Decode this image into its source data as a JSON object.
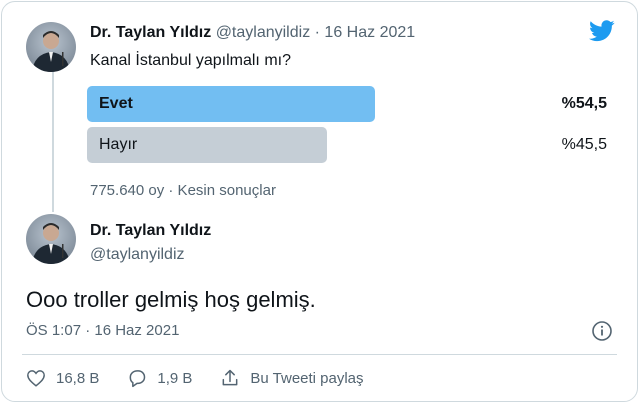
{
  "tweet_quoted": {
    "author_name": "Dr. Taylan Yıldız",
    "author_handle": "@taylanyildiz",
    "separator": "·",
    "date": "16 Haz 2021",
    "question": "Kanal İstanbul yapılmalı mı?",
    "poll": {
      "options": [
        {
          "label": "Evet",
          "percent_text": "%54,5",
          "percent": 54.5,
          "winner": true
        },
        {
          "label": "Hayır",
          "percent_text": "%45,5",
          "percent": 45.5,
          "winner": false
        }
      ],
      "footer": "775.640 oy · Kesin sonuçlar"
    }
  },
  "tweet_main": {
    "author_name": "Dr. Taylan Yıldız",
    "author_handle": "@taylanyildiz",
    "text": "Ooo troller gelmiş hoş gelmiş.",
    "timestamp": "ÖS 1:07 · 16 Haz 2021"
  },
  "actions": {
    "likes": "16,8 B",
    "replies": "1,9 B",
    "share_label": "Bu Tweeti paylaş"
  },
  "colors": {
    "winner_bar": "#72bef2",
    "loser_bar": "#c5ced6",
    "twitter_blue": "#1d9bf0"
  },
  "icons": [
    "twitter-bird-icon",
    "info-icon",
    "heart-icon",
    "reply-icon",
    "share-icon"
  ]
}
